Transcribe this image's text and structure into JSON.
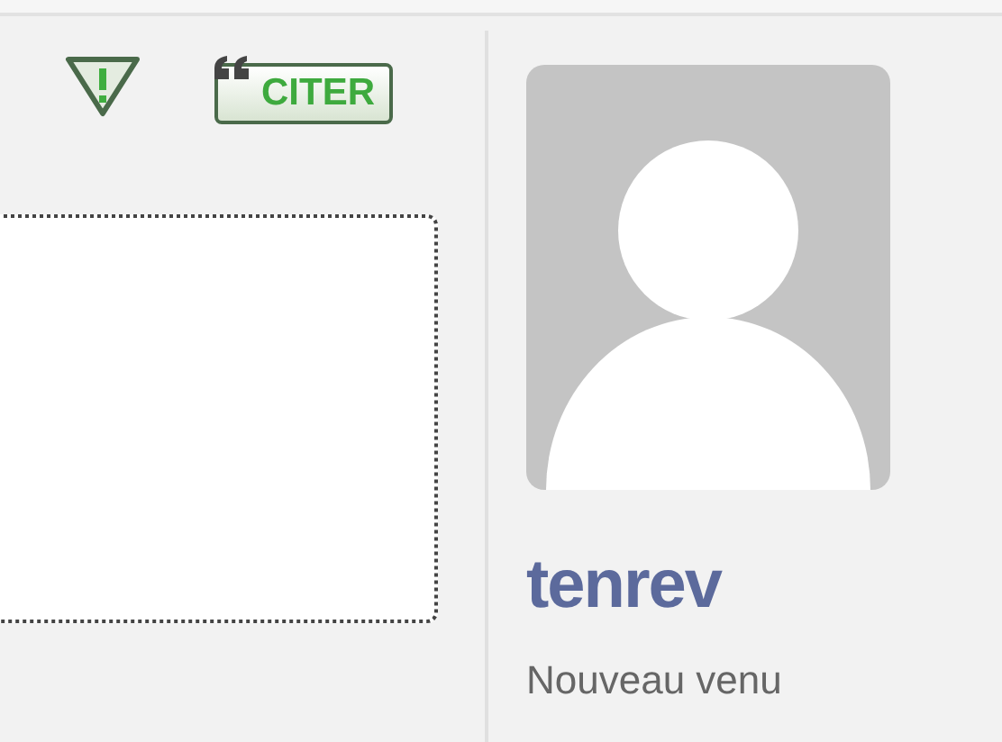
{
  "post": {
    "quote_button": {
      "label": "CITER"
    }
  },
  "author": {
    "username": "tenrev",
    "rank": "Nouveau venu"
  }
}
